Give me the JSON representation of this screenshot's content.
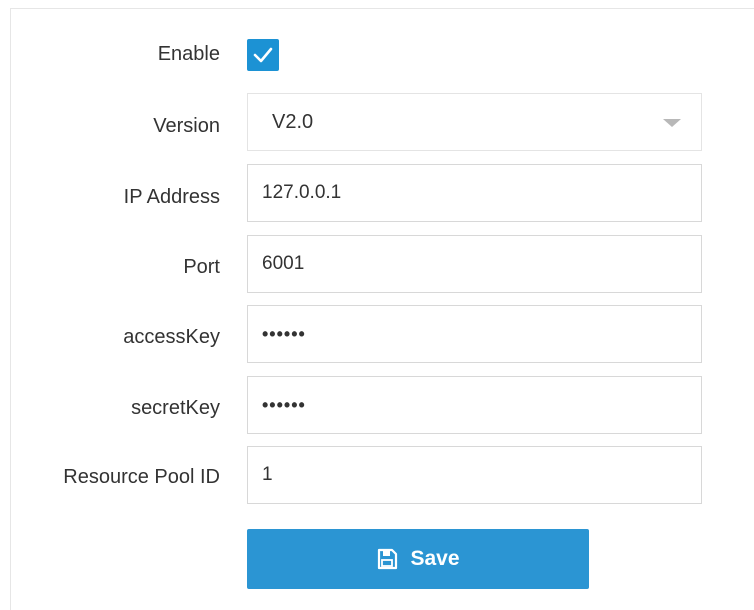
{
  "form": {
    "enable": {
      "label": "Enable",
      "checked": true
    },
    "version": {
      "label": "Version",
      "value": "V2.0"
    },
    "ip_address": {
      "label": "IP Address",
      "value": "127.0.0.1"
    },
    "port": {
      "label": "Port",
      "value": "6001"
    },
    "access_key": {
      "label": "accessKey",
      "value": "••••••"
    },
    "secret_key": {
      "label": "secretKey",
      "value": "••••••"
    },
    "resource_pool_id": {
      "label": "Resource Pool ID",
      "value": "1"
    }
  },
  "actions": {
    "save_label": "Save",
    "save_icon": "floppy-disk-icon"
  },
  "colors": {
    "accent": "#2b95d3",
    "checkbox": "#1c92d4"
  }
}
